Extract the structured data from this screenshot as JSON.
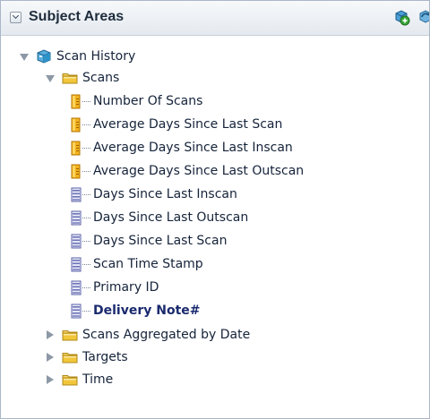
{
  "panel": {
    "title": "Subject Areas",
    "actions": [
      {
        "icon": "add-subject-area-icon"
      },
      {
        "icon": "refresh-icon"
      }
    ]
  },
  "tree": {
    "root": {
      "label": "Scan History",
      "expanded": true,
      "icon": "cube-icon"
    },
    "scans_folder": {
      "label": "Scans",
      "expanded": true,
      "icon": "folder-icon"
    },
    "measures": [
      {
        "label": "Number Of Scans",
        "icon": "measure-icon"
      },
      {
        "label": "Average Days Since Last Scan",
        "icon": "measure-icon"
      },
      {
        "label": "Average Days Since Last Inscan",
        "icon": "measure-icon"
      },
      {
        "label": "Average Days Since Last Outscan",
        "icon": "measure-icon"
      }
    ],
    "attributes": [
      {
        "label": "Days Since Last Inscan",
        "icon": "attribute-icon"
      },
      {
        "label": "Days Since Last Outscan",
        "icon": "attribute-icon"
      },
      {
        "label": "Days Since Last Scan",
        "icon": "attribute-icon"
      },
      {
        "label": "Scan Time Stamp",
        "icon": "attribute-icon"
      },
      {
        "label": "Primary ID",
        "icon": "attribute-icon"
      },
      {
        "label": "Delivery Note#",
        "icon": "attribute-icon",
        "selected": true
      }
    ],
    "other_folders": [
      {
        "label": "Scans Aggregated by Date",
        "expanded": false
      },
      {
        "label": "Targets",
        "expanded": false
      },
      {
        "label": "Time",
        "expanded": false
      }
    ]
  },
  "colors": {
    "folder": "#f1c63a",
    "measure": "#f4b21c",
    "attribute": "#6d73b8",
    "cube": "#2d93c9",
    "selected_text": "#1a2a6e"
  }
}
